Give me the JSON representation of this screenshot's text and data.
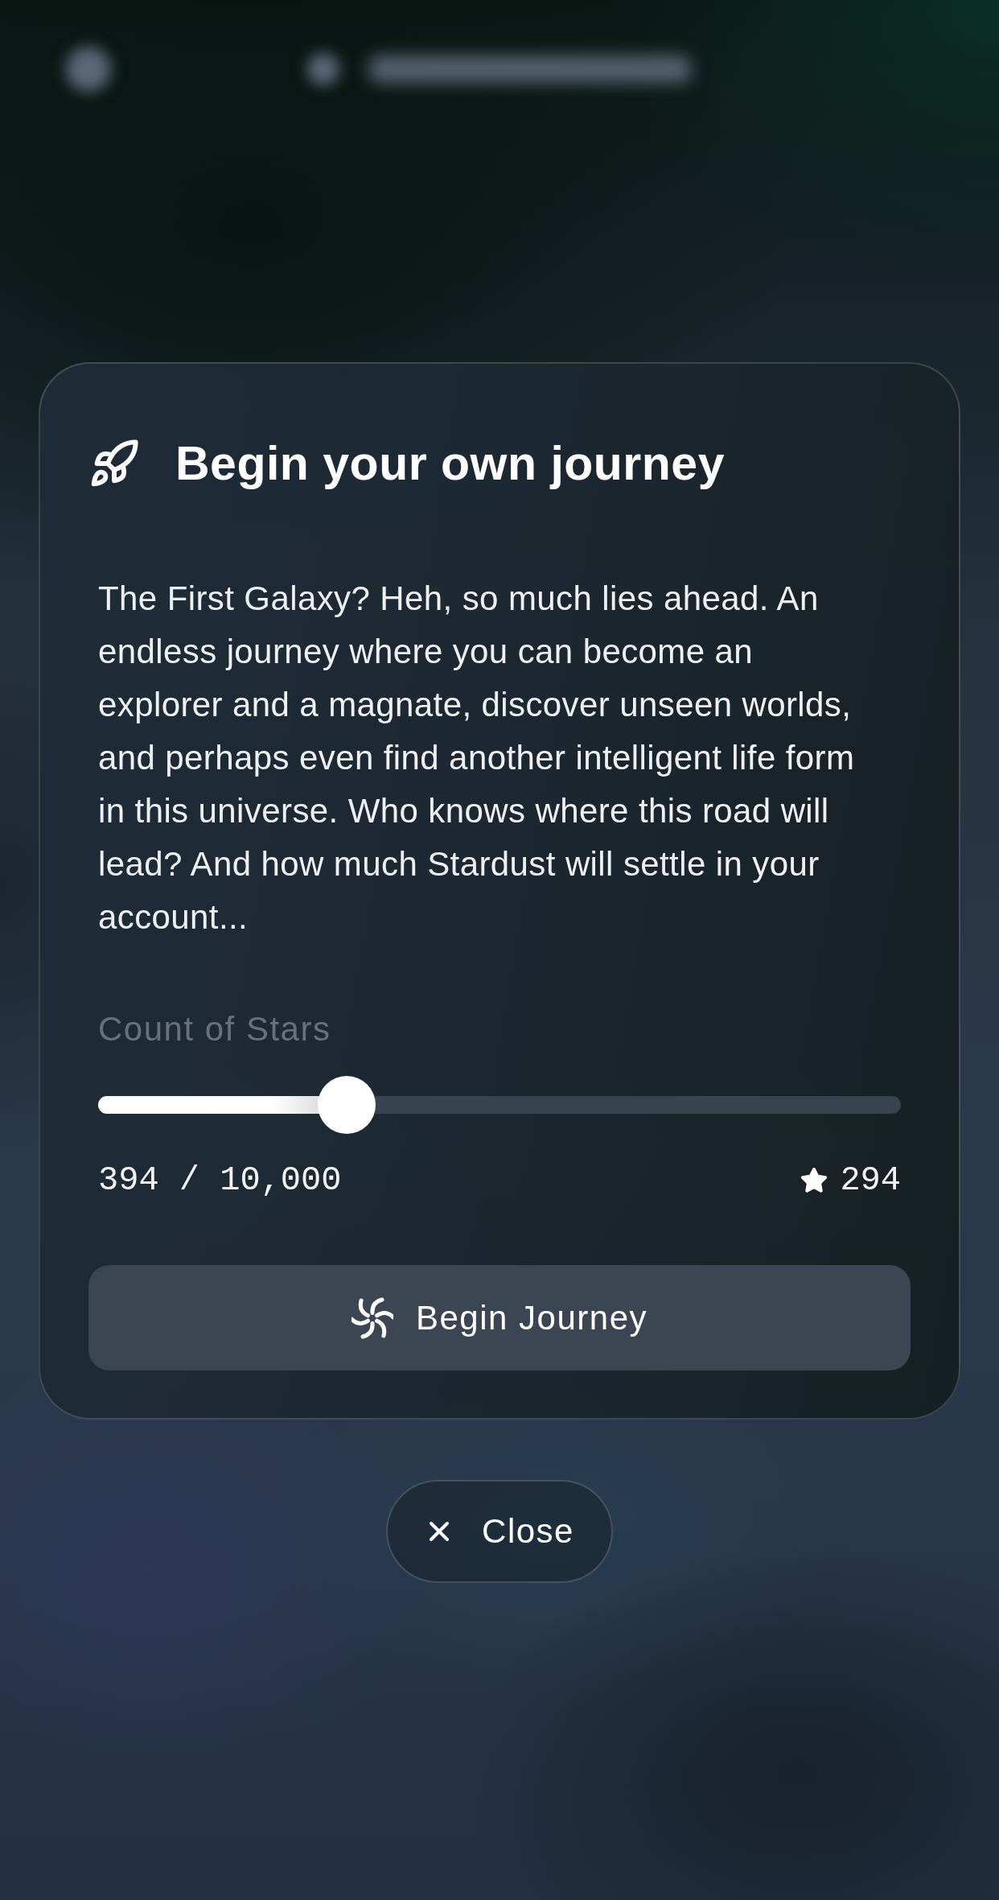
{
  "dialog": {
    "title": "Begin your own journey",
    "body": "The First Galaxy? Heh, so much lies ahead. An endless journey where you can become an explorer and a magnate, discover unseen worlds, and perhaps even find another intelligent life form in this universe. Who knows where this road will lead? And how much Stardust will settle in your account...",
    "slider": {
      "label": "Count of Stars",
      "level": 0.31,
      "reading": "394 / 10,000",
      "balance": "294"
    },
    "primary_button": {
      "label": "Begin Journey"
    }
  },
  "close_button": {
    "label": "Close"
  }
}
